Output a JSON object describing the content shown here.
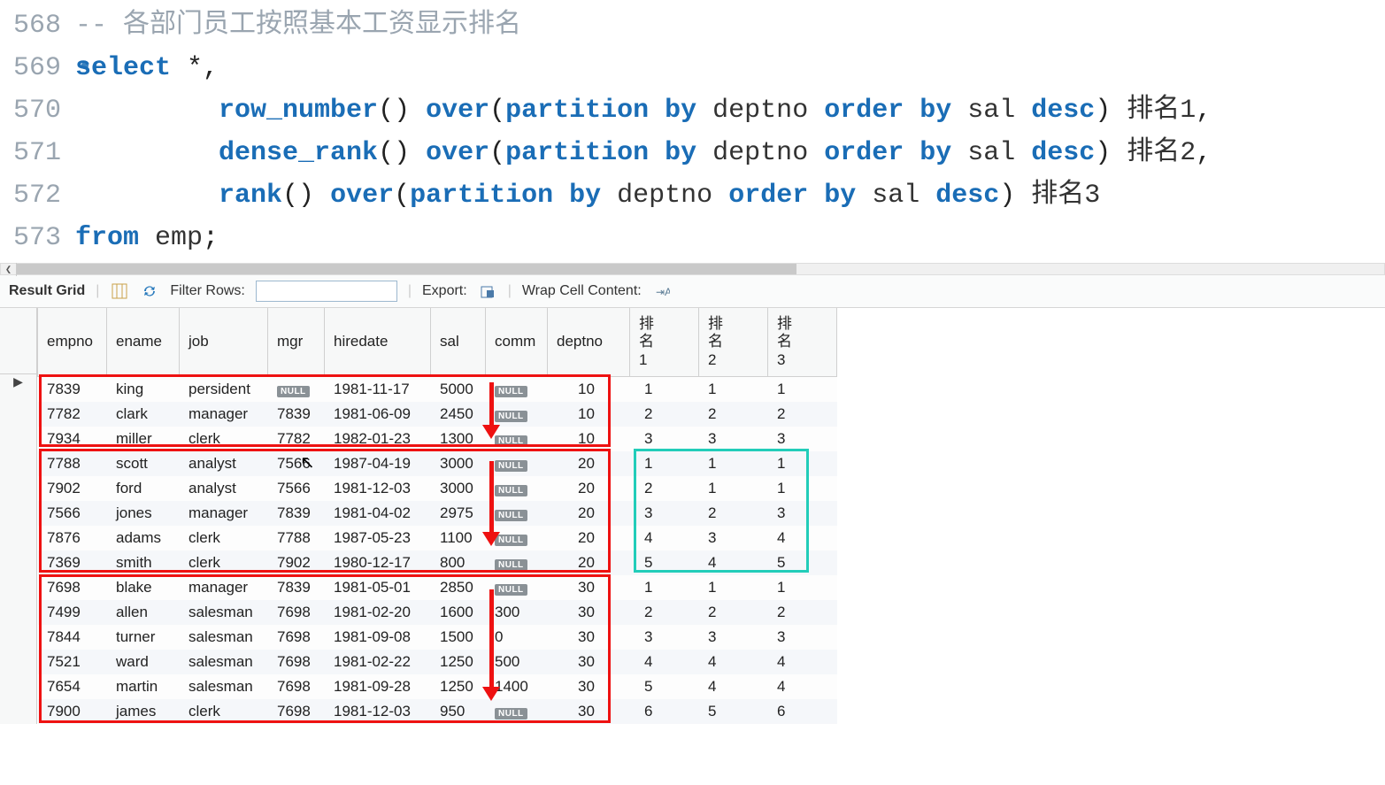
{
  "editor": {
    "lines": [
      {
        "num": "568",
        "modified": false
      },
      {
        "num": "569",
        "modified": true
      },
      {
        "num": "570",
        "modified": false
      },
      {
        "num": "571",
        "modified": false
      },
      {
        "num": "572",
        "modified": false
      },
      {
        "num": "573",
        "modified": false
      }
    ],
    "comment_prefix": "-- ",
    "comment_text": "各部门员工按照基本工资显示排名",
    "kw_select": "select",
    "star_comma": " *,",
    "fn_row_number": "row_number",
    "fn_dense_rank": "dense_rank",
    "fn_rank": "rank",
    "paren": "()",
    "kw_over": "over",
    "open_paren": "(",
    "kw_partition_by": "partition by",
    "ident_deptno": " deptno ",
    "kw_order_by": "order by",
    "ident_sal": " sal ",
    "kw_desc": "desc",
    "close_paren": ")",
    "alias1": " 排名1",
    "alias2": " 排名2",
    "alias3": " 排名3",
    "comma": ",",
    "kw_from": "from",
    "ident_emp": " emp",
    "semicolon": ";"
  },
  "toolbar": {
    "result_grid": "Result Grid",
    "filter_rows": "Filter Rows:",
    "export": "Export:",
    "wrap_cell": "Wrap Cell Content:"
  },
  "grid": {
    "headers": {
      "empno": "empno",
      "ename": "ename",
      "job": "job",
      "mgr": "mgr",
      "hiredate": "hiredate",
      "sal": "sal",
      "comm": "comm",
      "deptno": "deptno",
      "r1": "排\n名\n1",
      "r2": "排\n名\n2",
      "r3": "排\n名\n3"
    },
    "null_label": "NULL",
    "rows": [
      {
        "marker": "▶",
        "empno": "7839",
        "ename": "king",
        "job": "persident",
        "mgr": null,
        "hiredate": "1981-11-17",
        "sal": "5000",
        "comm": null,
        "deptno": "10",
        "r1": "1",
        "r2": "1",
        "r3": "1"
      },
      {
        "marker": "",
        "empno": "7782",
        "ename": "clark",
        "job": "manager",
        "mgr": "7839",
        "hiredate": "1981-06-09",
        "sal": "2450",
        "comm": null,
        "deptno": "10",
        "r1": "2",
        "r2": "2",
        "r3": "2"
      },
      {
        "marker": "",
        "empno": "7934",
        "ename": "miller",
        "job": "clerk",
        "mgr": "7782",
        "hiredate": "1982-01-23",
        "sal": "1300",
        "comm": null,
        "deptno": "10",
        "r1": "3",
        "r2": "3",
        "r3": "3"
      },
      {
        "marker": "",
        "empno": "7788",
        "ename": "scott",
        "job": "analyst",
        "mgr": "7566",
        "hiredate": "1987-04-19",
        "sal": "3000",
        "comm": null,
        "deptno": "20",
        "r1": "1",
        "r2": "1",
        "r3": "1"
      },
      {
        "marker": "",
        "empno": "7902",
        "ename": "ford",
        "job": "analyst",
        "mgr": "7566",
        "hiredate": "1981-12-03",
        "sal": "3000",
        "comm": null,
        "deptno": "20",
        "r1": "2",
        "r2": "1",
        "r3": "1"
      },
      {
        "marker": "",
        "empno": "7566",
        "ename": "jones",
        "job": "manager",
        "mgr": "7839",
        "hiredate": "1981-04-02",
        "sal": "2975",
        "comm": null,
        "deptno": "20",
        "r1": "3",
        "r2": "2",
        "r3": "3"
      },
      {
        "marker": "",
        "empno": "7876",
        "ename": "adams",
        "job": "clerk",
        "mgr": "7788",
        "hiredate": "1987-05-23",
        "sal": "1100",
        "comm": null,
        "deptno": "20",
        "r1": "4",
        "r2": "3",
        "r3": "4"
      },
      {
        "marker": "",
        "empno": "7369",
        "ename": "smith",
        "job": "clerk",
        "mgr": "7902",
        "hiredate": "1980-12-17",
        "sal": "800",
        "comm": null,
        "deptno": "20",
        "r1": "5",
        "r2": "4",
        "r3": "5"
      },
      {
        "marker": "",
        "empno": "7698",
        "ename": "blake",
        "job": "manager",
        "mgr": "7839",
        "hiredate": "1981-05-01",
        "sal": "2850",
        "comm": null,
        "deptno": "30",
        "r1": "1",
        "r2": "1",
        "r3": "1"
      },
      {
        "marker": "",
        "empno": "7499",
        "ename": "allen",
        "job": "salesman",
        "mgr": "7698",
        "hiredate": "1981-02-20",
        "sal": "1600",
        "comm": "300",
        "deptno": "30",
        "r1": "2",
        "r2": "2",
        "r3": "2"
      },
      {
        "marker": "",
        "empno": "7844",
        "ename": "turner",
        "job": "salesman",
        "mgr": "7698",
        "hiredate": "1981-09-08",
        "sal": "1500",
        "comm": "0",
        "deptno": "30",
        "r1": "3",
        "r2": "3",
        "r3": "3"
      },
      {
        "marker": "",
        "empno": "7521",
        "ename": "ward",
        "job": "salesman",
        "mgr": "7698",
        "hiredate": "1981-02-22",
        "sal": "1250",
        "comm": "500",
        "deptno": "30",
        "r1": "4",
        "r2": "4",
        "r3": "4"
      },
      {
        "marker": "",
        "empno": "7654",
        "ename": "martin",
        "job": "salesman",
        "mgr": "7698",
        "hiredate": "1981-09-28",
        "sal": "1250",
        "comm": "1400",
        "deptno": "30",
        "r1": "5",
        "r2": "4",
        "r3": "4"
      },
      {
        "marker": "",
        "empno": "7900",
        "ename": "james",
        "job": "clerk",
        "mgr": "7698",
        "hiredate": "1981-12-03",
        "sal": "950",
        "comm": null,
        "deptno": "30",
        "r1": "6",
        "r2": "5",
        "r3": "6"
      }
    ]
  }
}
